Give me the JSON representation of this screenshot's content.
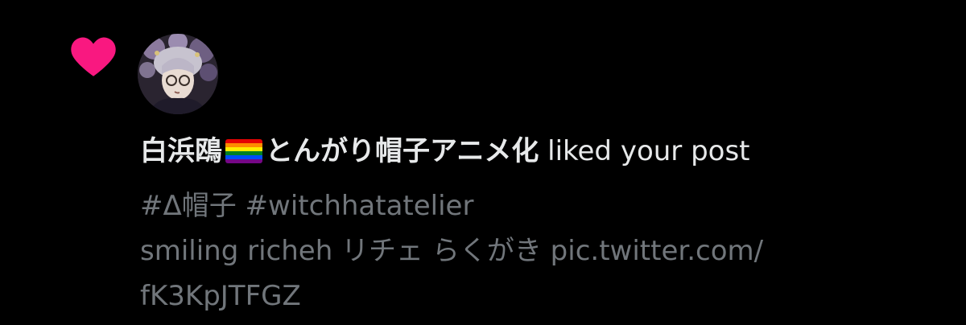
{
  "colors": {
    "background": "#000000",
    "heart": "#f91880",
    "primary_text": "#e7e9ea",
    "secondary_text": "#71767b"
  },
  "notification": {
    "type_icon": "heart-icon",
    "avatar_icon": "user-avatar",
    "liker_name_before_flag": "白浜鴎",
    "flag_icon": "rainbow-flag-icon",
    "liker_name_after_flag": "とんがり帽子アニメ化",
    "action_text": "liked your post",
    "post": {
      "tags_line": "#Δ帽子 #witchhatatelier",
      "text_line": "smiling richeh リチェ らくがき pic.twitter.com/",
      "link_continuation": "fK3KpJTFGZ"
    }
  }
}
